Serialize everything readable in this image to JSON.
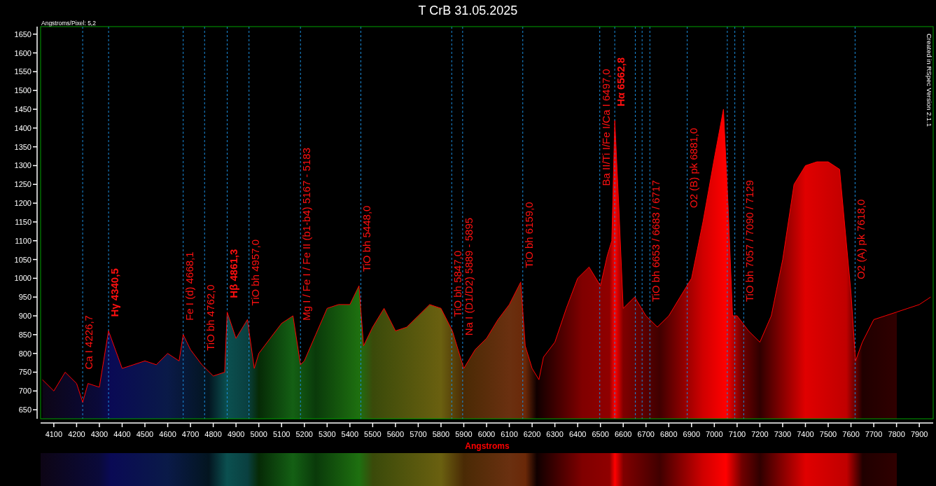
{
  "title": "T CrB 31.05.2025",
  "caption": "Angstroms/Pixel: 5,2",
  "credit": "Created in RSpec Version 2.1.1",
  "chart_data": {
    "type": "area",
    "xlabel": "Angstroms",
    "xlim": [
      4042,
      7961
    ],
    "ylim": [
      626,
      1670
    ],
    "xticks": [
      4100,
      4200,
      4300,
      4400,
      4500,
      4600,
      4700,
      4800,
      4900,
      5000,
      5100,
      5200,
      5300,
      5400,
      5500,
      5600,
      5700,
      5800,
      5900,
      6000,
      6100,
      6200,
      6300,
      6400,
      6500,
      6600,
      6700,
      6800,
      6900,
      7000,
      7100,
      7200,
      7300,
      7400,
      7500,
      7600,
      7700,
      7800,
      7900
    ],
    "yticks": [
      650,
      700,
      750,
      800,
      850,
      900,
      950,
      1000,
      1050,
      1100,
      1150,
      1200,
      1250,
      1300,
      1350,
      1400,
      1450,
      1500,
      1550,
      1600,
      1650
    ],
    "x": [
      4050,
      4100,
      4150,
      4200,
      4227,
      4250,
      4300,
      4340,
      4400,
      4450,
      4500,
      4550,
      4600,
      4650,
      4668,
      4700,
      4750,
      4800,
      4850,
      4861,
      4900,
      4950,
      4980,
      5000,
      5050,
      5100,
      5150,
      5183,
      5200,
      5250,
      5300,
      5350,
      5400,
      5440,
      5460,
      5500,
      5550,
      5600,
      5650,
      5700,
      5750,
      5800,
      5850,
      5900,
      5950,
      6000,
      6050,
      6100,
      6150,
      6170,
      6200,
      6230,
      6250,
      6300,
      6350,
      6400,
      6450,
      6500,
      6530,
      6550,
      6563,
      6580,
      6600,
      6650,
      6700,
      6750,
      6800,
      6850,
      6900,
      6950,
      7000,
      7040,
      7060,
      7080,
      7100,
      7150,
      7200,
      7250,
      7300,
      7350,
      7400,
      7450,
      7500,
      7550,
      7600,
      7620,
      7650,
      7700,
      7750,
      7800,
      7850,
      7900,
      7950
    ],
    "series": [
      {
        "color": "#ff0000",
        "values": [
          730,
          700,
          750,
          720,
          670,
          720,
          710,
          860,
          760,
          770,
          780,
          770,
          800,
          780,
          850,
          810,
          770,
          740,
          750,
          910,
          840,
          890,
          760,
          800,
          840,
          880,
          900,
          770,
          780,
          850,
          920,
          930,
          930,
          980,
          820,
          870,
          920,
          860,
          870,
          900,
          930,
          920,
          860,
          760,
          810,
          840,
          890,
          930,
          990,
          820,
          760,
          730,
          790,
          830,
          920,
          1000,
          1030,
          980,
          1060,
          1100,
          1420,
          1200,
          920,
          950,
          900,
          870,
          900,
          950,
          1000,
          1150,
          1320,
          1450,
          1200,
          900,
          900,
          860,
          830,
          900,
          1050,
          1250,
          1300,
          1310,
          1310,
          1290,
          960,
          780,
          830,
          890,
          900,
          910,
          920,
          930,
          950
        ]
      }
    ],
    "grid": false,
    "ref_lines": [
      {
        "axis": "x",
        "value": 4226.7,
        "label": "Ca I 4226,7"
      },
      {
        "axis": "x",
        "value": 4340.5,
        "label": "Hγ 4340,5"
      },
      {
        "axis": "x",
        "value": 4668.1,
        "label": "Fe I (d) 4668,1"
      },
      {
        "axis": "x",
        "value": 4762.0,
        "label": "TiO bh 4762,0"
      },
      {
        "axis": "x",
        "value": 4861.3,
        "label": "Hβ 4861,3"
      },
      {
        "axis": "x",
        "value": 4957.0,
        "label": "TiO bh 4957,0"
      },
      {
        "axis": "x",
        "value": 5183,
        "label": "Mg I / Fe I / Fe II  (b1-b4) 5167 - 5183"
      },
      {
        "axis": "x",
        "value": 5448.0,
        "label": "TiO bh 5448,0"
      },
      {
        "axis": "x",
        "value": 5847.0,
        "label": "TiO bh 5847,0"
      },
      {
        "axis": "x",
        "value": 5895,
        "label": "Na I (D1/D2) 5889 - 5895"
      },
      {
        "axis": "x",
        "value": 6159.0,
        "label": "TiO bh 6159,0"
      },
      {
        "axis": "x",
        "value": 6497.0,
        "label": "Ba II/Ti I/Fe I/Ca I 6497,0"
      },
      {
        "axis": "x",
        "value": 6562.8,
        "label": "Hα 6562,8"
      },
      {
        "axis": "x",
        "value": 6653
      },
      {
        "axis": "x",
        "value": 6683
      },
      {
        "axis": "x",
        "value": 6717,
        "label": "TiO bh 6653 / 6683 / 6717"
      },
      {
        "axis": "x",
        "value": 6881.0,
        "label": "O2 (B) pk 6881,0"
      },
      {
        "axis": "x",
        "value": 7057
      },
      {
        "axis": "x",
        "value": 7090
      },
      {
        "axis": "x",
        "value": 7129,
        "label": "TiO bh 7057 / 7090 / 7129"
      },
      {
        "axis": "x",
        "value": 7618.0,
        "label": "O2 (A) pk 7618,0"
      }
    ]
  },
  "line_label_styles": [
    {
      "bold": false
    },
    {
      "bold": true
    },
    {
      "bold": false
    },
    {
      "bold": false
    },
    {
      "bold": true
    },
    {
      "bold": false
    },
    {
      "bold": false
    },
    {
      "bold": false
    },
    {
      "bold": false
    },
    {
      "bold": false
    },
    {
      "bold": false
    },
    {
      "bold": false
    },
    {
      "bold": true
    },
    {
      "bold": false
    },
    {
      "bold": false
    },
    {
      "bold": false
    },
    {
      "bold": false
    }
  ]
}
